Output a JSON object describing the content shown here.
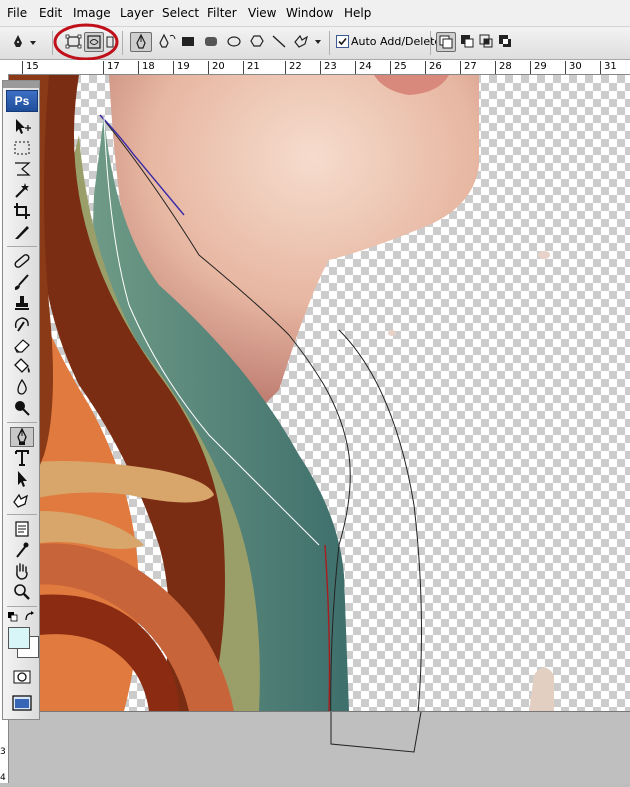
{
  "menu": [
    "File",
    "Edit",
    "Image",
    "Layer",
    "Select",
    "Filter",
    "View",
    "Window",
    "Help"
  ],
  "options_bar": {
    "auto_add_delete_label": "Auto Add/Delete",
    "auto_add_delete_checked": true
  },
  "ruler_top_labels": [
    "17",
    "18",
    "19",
    "20",
    "21",
    "22",
    "23",
    "24",
    "25",
    "26",
    "27",
    "28",
    "29",
    "30",
    "31"
  ],
  "ruler_top_partial_left": "15",
  "ruler_left_labels": [
    "3",
    "4"
  ],
  "toolbox": {
    "logo": "Ps",
    "tools": [
      "move",
      "marquee",
      "lasso",
      "magic-wand",
      "crop",
      "slice",
      "healing-brush",
      "brush",
      "clone-stamp",
      "history-brush",
      "eraser",
      "paint-bucket",
      "blur",
      "dodge",
      "pen",
      "type",
      "path-selection",
      "custom-shape",
      "notes",
      "eyedropper",
      "hand",
      "zoom"
    ],
    "foreground_color": "#000000",
    "background_color": "#ffffff",
    "swatch_color": "#d8f5f7"
  },
  "colors": {
    "annotation_circle": "#c0101a",
    "menubar_bg": "#f0f0f0",
    "pasteboard": "#bfbfbf"
  }
}
